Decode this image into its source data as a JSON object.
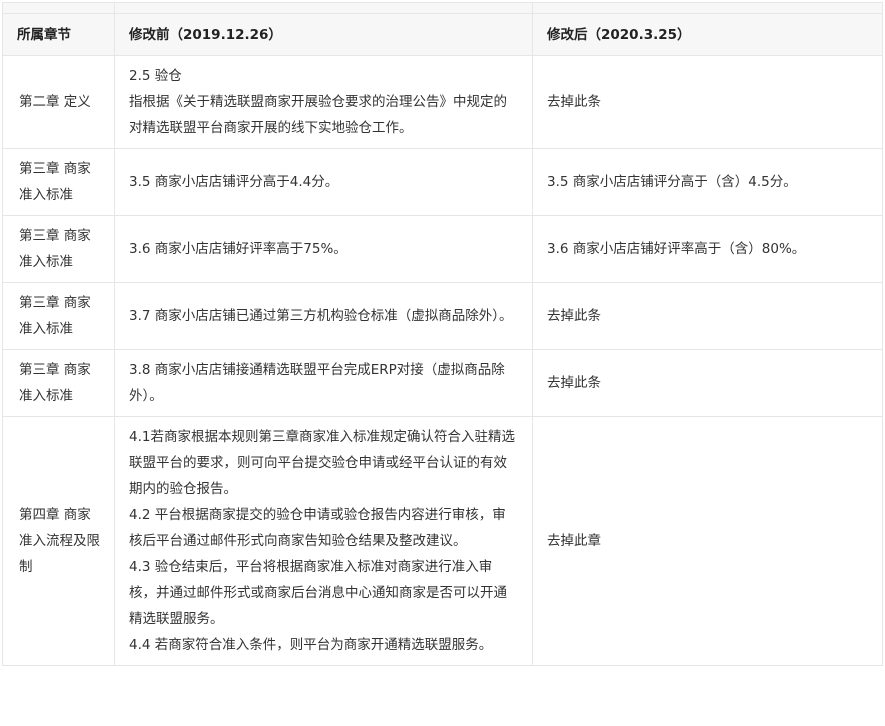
{
  "header": {
    "col1": "所属章节",
    "col2": "修改前（2019.12.26）",
    "col3": "修改后（2020.3.25）"
  },
  "rows": [
    {
      "chapter": "第二章 定义",
      "before": [
        "2.5 验仓",
        "指根据《关于精选联盟商家开展验仓要求的治理公告》中规定的对精选联盟平台商家开展的线下实地验仓工作。"
      ],
      "after": "去掉此条"
    },
    {
      "chapter": "第三章 商家准入标准",
      "before": [
        "3.5 商家小店店铺评分高于4.4分。"
      ],
      "after": "3.5 商家小店店铺评分高于（含）4.5分。"
    },
    {
      "chapter": "第三章 商家准入标准",
      "before": [
        "3.6 商家小店店铺好评率高于75%。"
      ],
      "after": "3.6 商家小店店铺好评率高于（含）80%。"
    },
    {
      "chapter": "第三章 商家准入标准",
      "before": [
        "3.7 商家小店店铺已通过第三方机构验仓标准（虚拟商品除外）。"
      ],
      "after": "去掉此条"
    },
    {
      "chapter": "第三章 商家准入标准",
      "before": [
        "3.8 商家小店店铺接通精选联盟平台完成ERP对接（虚拟商品除外）。"
      ],
      "after": "去掉此条"
    },
    {
      "chapter": "第四章 商家准入流程及限制",
      "before": [
        "4.1若商家根据本规则第三章商家准入标准规定确认符合入驻精选联盟平台的要求，则可向平台提交验仓申请或经平台认证的有效期内的验仓报告。",
        "4.2 平台根据商家提交的验仓申请或验仓报告内容进行审核，审核后平台通过邮件形式向商家告知验仓结果及整改建议。",
        "4.3 验仓结束后，平台将根据商家准入标准对商家进行准入审核，并通过邮件形式或商家后台消息中心通知商家是否可以开通精选联盟服务。",
        "4.4 若商家符合准入条件，则平台为商家开通精选联盟服务。"
      ],
      "after": "去掉此章"
    }
  ]
}
